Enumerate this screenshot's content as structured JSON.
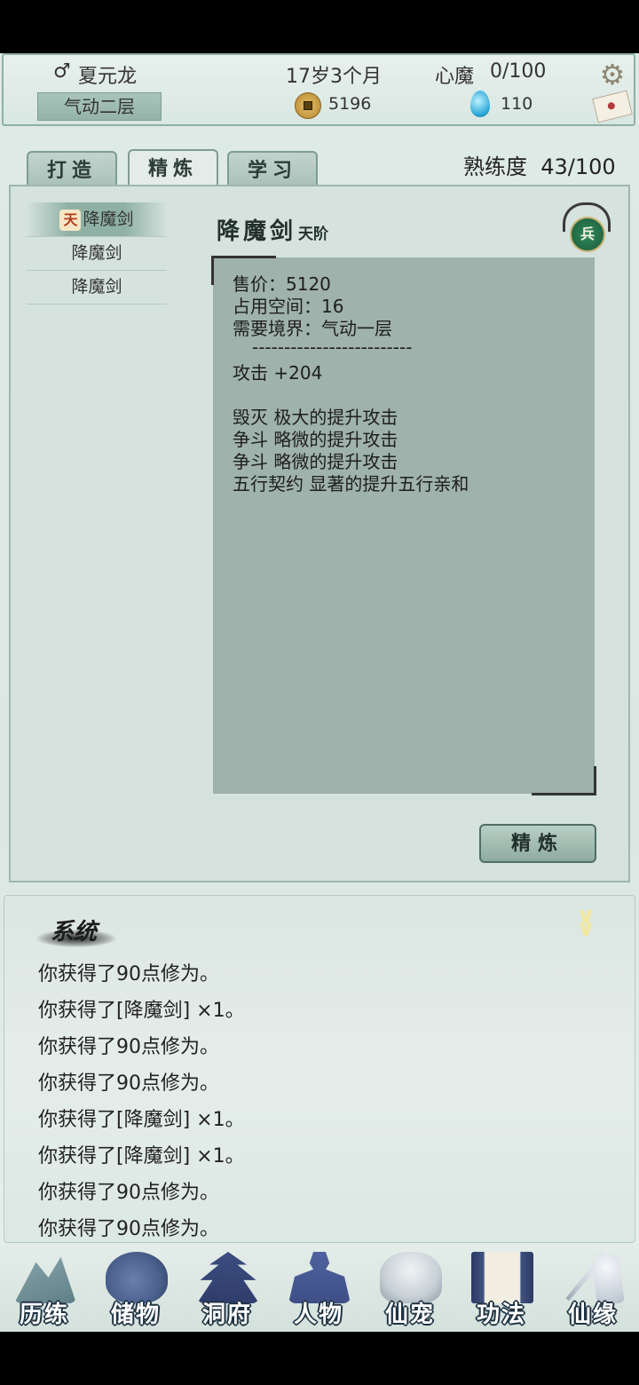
{
  "header": {
    "player_name": "夏元龙",
    "realm": "气动二层",
    "age": "17岁3个月",
    "heart_demon_label": "心魔",
    "heart_demon_value": "0/100",
    "coins": "5196",
    "spirit_stones": "110"
  },
  "tabs": [
    {
      "label": "打造",
      "active": false
    },
    {
      "label": "精炼",
      "active": true
    },
    {
      "label": "学习",
      "active": false
    }
  ],
  "mastery": {
    "label": "熟练度",
    "value": "43/100"
  },
  "item_list": [
    {
      "label": "降魔剑",
      "tier_icon": "天",
      "selected": true
    },
    {
      "label": "降魔剑",
      "selected": false
    },
    {
      "label": "降魔剑",
      "selected": false
    }
  ],
  "detail": {
    "title": "降魔剑",
    "grade": "天阶",
    "type_badge": "兵",
    "lines": [
      "售价：5120",
      "占用空间：16",
      "需要境界：气动一层",
      "-------------------------",
      "攻击 +204",
      "",
      "毁灭 极大的提升攻击",
      "争斗 略微的提升攻击",
      "争斗 略微的提升攻击",
      "五行契约 显著的提升五行亲和"
    ]
  },
  "refine_button": "精炼",
  "system_log": {
    "title": "系统",
    "entries": [
      "你获得了90点修为。",
      "你获得了[降魔剑] ×1。",
      "你获得了90点修为。",
      "你获得了90点修为。",
      "你获得了[降魔剑] ×1。",
      "你获得了[降魔剑] ×1。",
      "你获得了90点修为。",
      "你获得了90点修为。"
    ]
  },
  "nav": [
    {
      "label": "历练",
      "icon": "mountain-icon",
      "color": "#5f7f86"
    },
    {
      "label": "储物",
      "icon": "bag-icon",
      "color": "#4a5f8c"
    },
    {
      "label": "洞府",
      "icon": "pagoda-icon",
      "color": "#2f3d6b"
    },
    {
      "label": "人物",
      "icon": "person-icon",
      "color": "#3e4f86"
    },
    {
      "label": "仙宠",
      "icon": "spirit-pet-icon",
      "color": "#c7d0d6"
    },
    {
      "label": "功法",
      "icon": "scroll-icon",
      "color": "#3f5280"
    },
    {
      "label": "仙缘",
      "icon": "crane-icon",
      "color": "#c6cfd8"
    }
  ],
  "colors": {
    "accent": "#8fb1a5",
    "panel": "#d5e2dd",
    "detail_bg": "#9fb2ac",
    "nav_label_outline": "#1f3242"
  }
}
